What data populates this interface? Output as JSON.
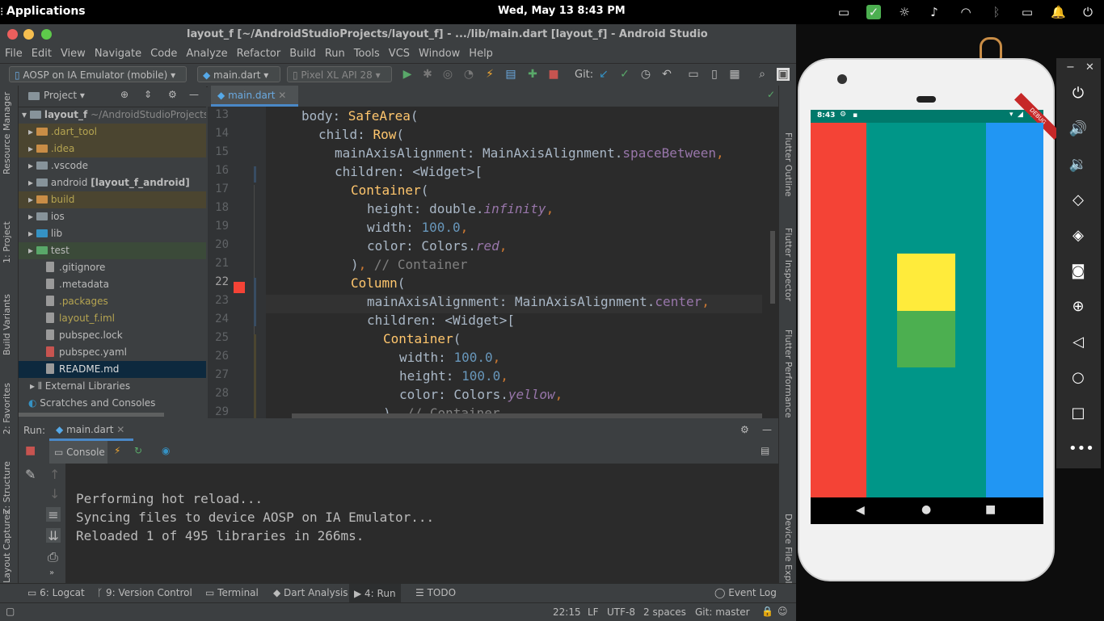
{
  "topbar": {
    "apps_label": "Applications",
    "clock": "Wed, May 13   8:43 PM"
  },
  "studio": {
    "title": "layout_f [~/AndroidStudioProjects/layout_f] - .../lib/main.dart [layout_f] - Android Studio",
    "menu": [
      "File",
      "Edit",
      "View",
      "Navigate",
      "Code",
      "Analyze",
      "Refactor",
      "Build",
      "Run",
      "Tools",
      "VCS",
      "Window",
      "Help"
    ],
    "toolbar": {
      "device_combo": "AOSP on IA Emulator (mobile)",
      "file_combo": "main.dart",
      "avd_combo": "Pixel XL API 28",
      "git_label": "Git:"
    },
    "left_tabs": [
      "Resource Manager",
      "1: Project",
      "Build Variants",
      "2: Favorites",
      "Z: Structure",
      "Layout Captures"
    ],
    "right_tabs": [
      "Flutter Outline",
      "Flutter Inspector",
      "Flutter Performance",
      "Device File Explorer"
    ],
    "project": {
      "header": "Project",
      "root": "layout_f",
      "root_path": "~/AndroidStudioProjects/la",
      "items": [
        {
          "label": "dart_tool",
          "display": ".dart_tool",
          "kind": "folder-orange"
        },
        {
          "label": "idea",
          "display": ".idea",
          "kind": "folder-orange"
        },
        {
          "label": "vscode",
          "display": ".vscode",
          "kind": "folder-gray"
        },
        {
          "label": "android",
          "display": "android",
          "suffix": "[layout_f_android]",
          "kind": "folder-gray"
        },
        {
          "label": "build",
          "display": "build",
          "kind": "folder-orange"
        },
        {
          "label": "ios",
          "display": "ios",
          "kind": "folder-gray"
        },
        {
          "label": "lib",
          "display": "lib",
          "kind": "folder-blue"
        },
        {
          "label": "test",
          "display": "test",
          "kind": "folder-green"
        },
        {
          "label": "gitignore",
          "display": ".gitignore",
          "kind": "file"
        },
        {
          "label": "metadata",
          "display": ".metadata",
          "kind": "file"
        },
        {
          "label": "packages",
          "display": ".packages",
          "kind": "file"
        },
        {
          "label": "layout-iml",
          "display": "layout_f.iml",
          "kind": "file"
        },
        {
          "label": "pubspec-lock",
          "display": "pubspec.lock",
          "kind": "file"
        },
        {
          "label": "pubspec-yaml",
          "display": "pubspec.yaml",
          "kind": "file"
        },
        {
          "label": "readme",
          "display": "README.md",
          "kind": "file"
        }
      ],
      "external": "External Libraries",
      "scratches": "Scratches and Consoles"
    },
    "editor": {
      "tab": "main.dart",
      "line_numbers": [
        "13",
        "14",
        "15",
        "16",
        "17",
        "18",
        "19",
        "20",
        "21",
        "22",
        "23",
        "24",
        "25",
        "26",
        "27",
        "28",
        "29"
      ]
    },
    "run": {
      "label": "Run:",
      "tab": "main.dart",
      "console_tab": "Console",
      "lines": [
        "Performing hot reload...",
        "Syncing files to device AOSP on IA Emulator...",
        "Reloaded 1 of 495 libraries in 266ms."
      ]
    },
    "bottom_tools": [
      "6: Logcat",
      "9: Version Control",
      "Terminal",
      "Dart Analysis",
      "4: Run",
      "TODO",
      "Event Log"
    ],
    "status": {
      "position": "22:15",
      "line_sep": "LF",
      "encoding": "UTF-8",
      "indent": "2 spaces",
      "git": "Git: master"
    }
  },
  "emulator": {
    "status_time": "8:43",
    "debug_banner": "DEBUG",
    "colors": {
      "red": "#f44336",
      "teal": "#009688",
      "blue": "#2196f3",
      "yellow": "#ffeb3b",
      "green": "#4caf50"
    }
  }
}
